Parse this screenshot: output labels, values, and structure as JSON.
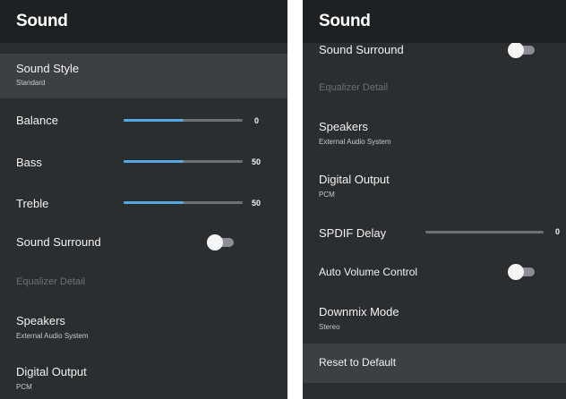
{
  "left": {
    "title": "Sound",
    "sound_style": {
      "label": "Sound Style",
      "value": "Standard"
    },
    "balance": {
      "label": "Balance",
      "value": "0",
      "level": 0.5
    },
    "bass": {
      "label": "Bass",
      "value": "50",
      "level": 0.5
    },
    "treble": {
      "label": "Treble",
      "value": "50",
      "level": 0.5
    },
    "sound_surround": {
      "label": "Sound Surround",
      "on": false
    },
    "equalizer": {
      "label": "Equalizer Detail"
    },
    "speakers": {
      "label": "Speakers",
      "value": "External Audio System"
    },
    "digital_output": {
      "label": "Digital Output",
      "value": "PCM"
    }
  },
  "right": {
    "title": "Sound",
    "sound_surround": {
      "label": "Sound Surround",
      "on": false
    },
    "equalizer": {
      "label": "Equalizer Detail"
    },
    "speakers": {
      "label": "Speakers",
      "value": "External Audio System"
    },
    "digital_output": {
      "label": "Digital Output",
      "value": "PCM"
    },
    "spdif_delay": {
      "label": "SPDIF Delay",
      "value": "0",
      "level": 0
    },
    "auto_volume": {
      "label": "Auto Volume Control",
      "on": false
    },
    "downmix": {
      "label": "Downmix Mode",
      "value": "Stereo"
    },
    "reset": {
      "label": "Reset to Default"
    }
  },
  "colors": {
    "panel": "#2b2e31",
    "header": "#1e2124",
    "selected_row": "#3c4044",
    "slider_fill": "#58a8e0",
    "slider_track": "#6d7175"
  }
}
